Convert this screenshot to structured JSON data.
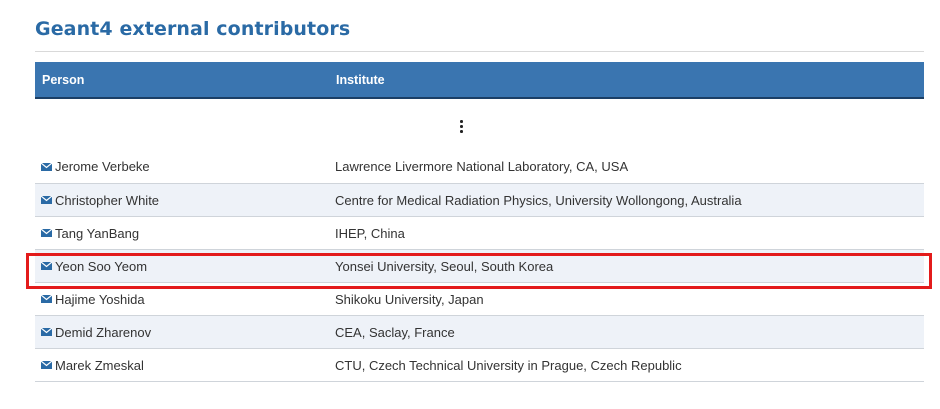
{
  "page": {
    "title": "Geant4 external contributors"
  },
  "table": {
    "headers": {
      "person": "Person",
      "institute": "Institute"
    },
    "ellipsis_icon": "vertical-ellipsis-icon",
    "rows": [
      {
        "person": "Jerome Verbeke",
        "institute": "Lawrence Livermore National Laboratory, CA, USA"
      },
      {
        "person": "Christopher White",
        "institute": "Centre for Medical Radiation Physics, University Wollongong, Australia"
      },
      {
        "person": "Tang YanBang",
        "institute": "IHEP, China"
      },
      {
        "person": "Yeon Soo Yeom",
        "institute": "Yonsei University, Seoul, South Korea"
      },
      {
        "person": "Hajime Yoshida",
        "institute": "Shikoku University, Japan"
      },
      {
        "person": "Demid Zharenov",
        "institute": "CEA, Saclay, France"
      },
      {
        "person": "Marek Zmeskal",
        "institute": "CTU, Czech Technical University in Prague, Czech Republic"
      }
    ],
    "row_icon": "envelope-icon",
    "highlighted_row_index": 3
  },
  "colors": {
    "title": "#2a6aa5",
    "header_bg": "#3a75b0",
    "alt_row_bg": "#eef2f8",
    "highlight": "#e31b1b"
  }
}
